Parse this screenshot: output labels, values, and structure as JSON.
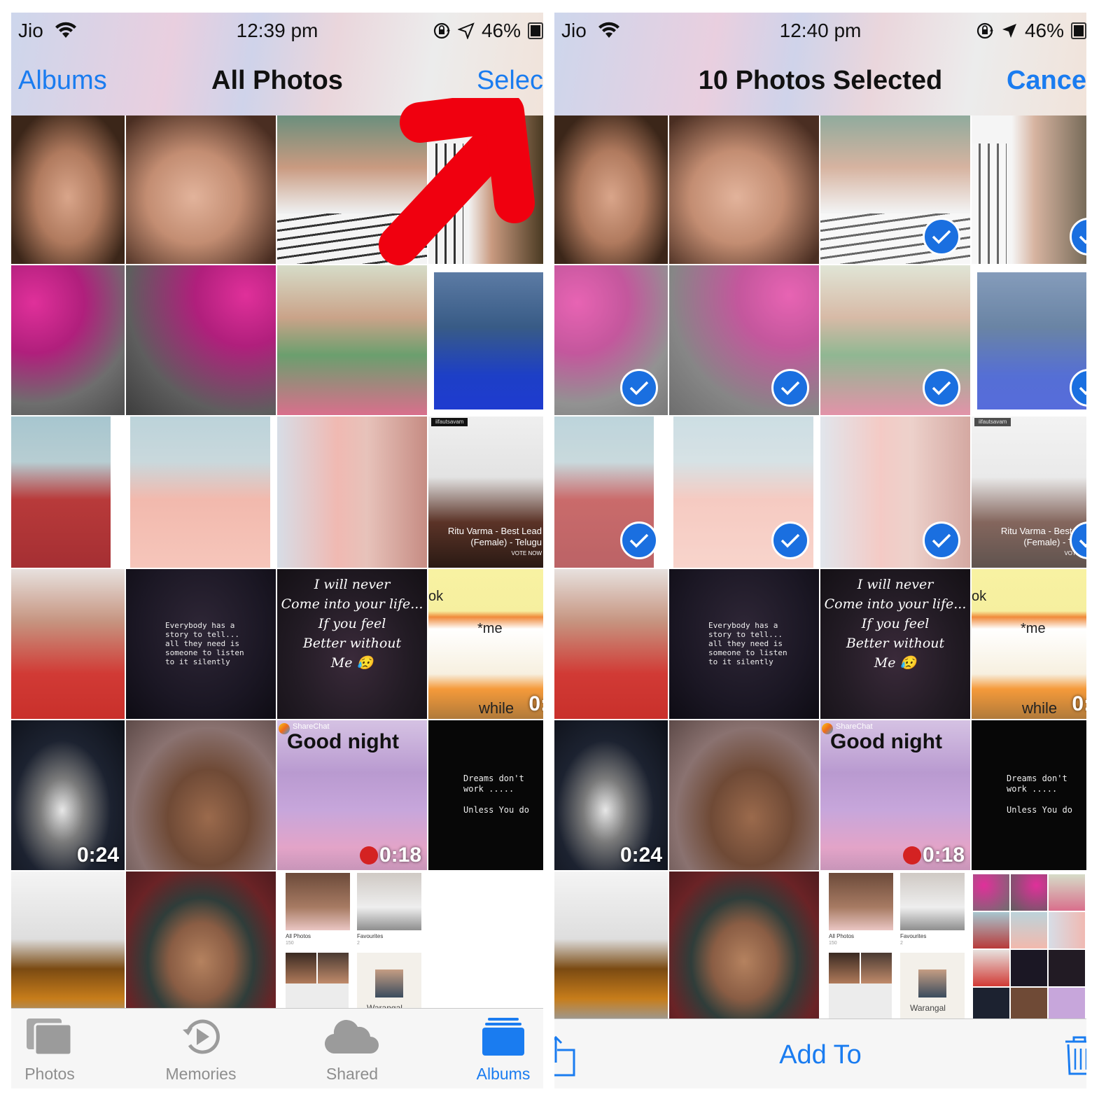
{
  "colors": {
    "accent": "#1a7cf0",
    "selection_badge": "#1a6fe0",
    "annotation_arrow": "#f0000f",
    "tab_inactive": "#8e8e8e"
  },
  "left_screen": {
    "status_bar": {
      "carrier": "Jio",
      "time": "12:39 pm",
      "battery": "46%",
      "icons": [
        "wifi-icon",
        "orientation-lock-icon",
        "location-arrow-icon",
        "battery-icon"
      ]
    },
    "nav": {
      "back_label": "Albums",
      "title": "All Photos",
      "action_label": "Selec"
    },
    "annotation": "red-arrow-pointing-to-select",
    "grid": {
      "text_tiles": {
        "story": "Everybody has a\nstory to tell...\nall they need is\nsomeone to listen\nto it silently",
        "quote": [
          "I will never",
          "Come into your life...",
          "If you feel",
          "Better without",
          "Me 😥"
        ],
        "cartoon_top": "ok",
        "cartoon_me": "*me",
        "cartoon_bottom": "while",
        "cartoon_duration": "0:",
        "good_night_brand": "ShareChat",
        "good_night": "Good night",
        "dreams": "Dreams don't\nwork .....\n\nUnless You do",
        "insta_tag": "iifautsavam",
        "award": "Ritu Varma - Best Lead\n(Female) - Telugu",
        "vote": "VOTE NOW"
      },
      "durations": [
        "0:24",
        "0:18"
      ],
      "albums_preview": {
        "all_photos_label": "All Photos",
        "all_photos_count": "150",
        "favourites_label": "Favourites",
        "favourites_count": "2",
        "map_label": "Warangal"
      }
    },
    "tabbar": {
      "tabs": [
        {
          "label": "Photos",
          "icon": "photos-stack-icon",
          "active": false
        },
        {
          "label": "Memories",
          "icon": "memories-replay-icon",
          "active": false
        },
        {
          "label": "Shared",
          "icon": "cloud-icon",
          "active": false
        },
        {
          "label": "Albums",
          "icon": "albums-stack-icon",
          "active": true
        }
      ]
    }
  },
  "right_screen": {
    "status_bar": {
      "carrier": "Jio",
      "time": "12:40 pm",
      "battery": "46%",
      "icons": [
        "wifi-icon",
        "orientation-lock-icon",
        "location-arrow-icon",
        "battery-icon"
      ]
    },
    "nav": {
      "title": "10 Photos Selected",
      "action_label": "Cance"
    },
    "selected_count": 10,
    "grid": {
      "durations": [
        "0:24",
        "0:18"
      ]
    },
    "toolbar": {
      "add_to_label": "Add To",
      "share_icon": "share-icon",
      "trash_icon": "trash-icon"
    }
  }
}
